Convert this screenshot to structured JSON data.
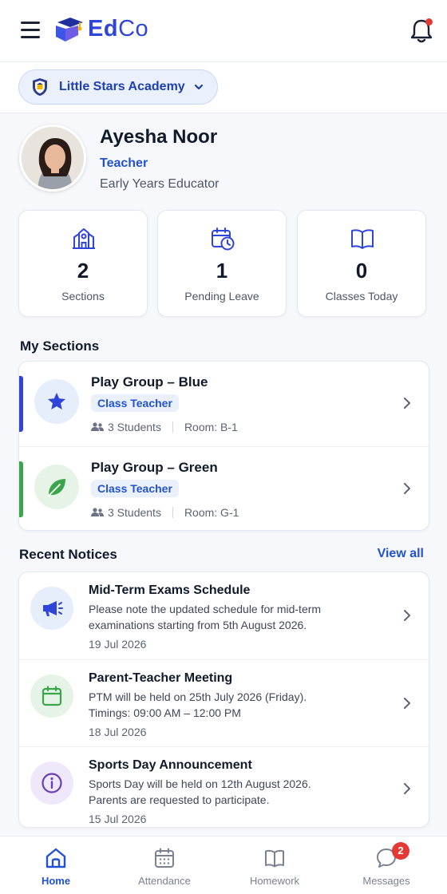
{
  "app": {
    "logo_primary": "Ed",
    "logo_secondary": "Co",
    "brand_color": "#2f45d8"
  },
  "header": {
    "menu_icon": "hamburger-menu-icon",
    "notification_icon": "bell-icon",
    "has_unread": true
  },
  "school": {
    "name": "Little Stars Academy",
    "icon": "school-shield-icon",
    "dropdown_icon": "chevron-down-icon"
  },
  "profile": {
    "name": "Ayesha Noor",
    "role": "Teacher",
    "description": "Early Years Educator"
  },
  "stats": [
    {
      "value": "2",
      "label": "Sections",
      "icon": "school-building-icon"
    },
    {
      "value": "1",
      "label": "Pending Leave",
      "icon": "calendar-clock-icon"
    },
    {
      "value": "0",
      "label": "Classes Today",
      "icon": "open-book-icon"
    }
  ],
  "sections": {
    "title": "My Sections",
    "items": [
      {
        "name": "Play Group – Blue",
        "badge": "Class Teacher",
        "students": "3 Students",
        "room": "Room: B-1",
        "accent": "#2f45d8",
        "icon": "star-icon"
      },
      {
        "name": "Play Group – Green",
        "badge": "Class Teacher",
        "students": "3 Students",
        "room": "Room: G-1",
        "accent": "#3aa54a",
        "icon": "leaf-icon"
      }
    ]
  },
  "notices": {
    "title": "Recent Notices",
    "view_all": "View all",
    "items": [
      {
        "title": "Mid-Term Exams Schedule",
        "line1": "Please note the updated schedule for mid-term",
        "line2": "examinations starting from 5th August 2026.",
        "date": "19 Jul 2026",
        "icon": "megaphone-icon"
      },
      {
        "title": "Parent-Teacher Meeting",
        "line1": "PTM will be held on 25th July 2026 (Friday).",
        "line2": "Timings: 09:00 AM – 12:00 PM",
        "date": "18 Jul 2026",
        "icon": "calendar-icon"
      },
      {
        "title": "Sports Day Announcement",
        "line1": "Sports Day will be held on 12th August 2026.",
        "line2": "Parents are requested to participate.",
        "date": "15 Jul 2026",
        "icon": "info-icon"
      }
    ]
  },
  "nav": {
    "items": [
      {
        "label": "Home",
        "icon": "home-icon",
        "active": true
      },
      {
        "label": "Attendance",
        "icon": "calendar-grid-icon",
        "active": false
      },
      {
        "label": "Homework",
        "icon": "book-icon",
        "active": false
      },
      {
        "label": "Messages",
        "icon": "chat-bubble-icon",
        "active": false,
        "badge": "2"
      }
    ]
  }
}
